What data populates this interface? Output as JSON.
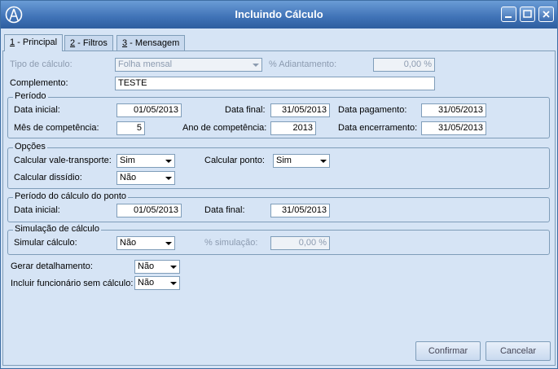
{
  "window": {
    "title": "Incluindo Cálculo"
  },
  "tabs": [
    {
      "num": "1",
      "label": " - Principal"
    },
    {
      "num": "2",
      "label": " - Filtros"
    },
    {
      "num": "3",
      "label": " - Mensagem"
    }
  ],
  "principal": {
    "tipo_calculo_label": "Tipo de cálculo:",
    "tipo_calculo_value": "Folha mensal",
    "adiantamento_label": "% Adiantamento:",
    "adiantamento_value": "0,00 %",
    "complemento_label": "Complemento:",
    "complemento_value": "TESTE"
  },
  "periodo": {
    "title": "Período",
    "data_inicial_label": "Data inicial:",
    "data_inicial_value": "01/05/2013",
    "data_final_label": "Data final:",
    "data_final_value": "31/05/2013",
    "data_pagamento_label": "Data pagamento:",
    "data_pagamento_value": "31/05/2013",
    "mes_label": "Mês de competência:",
    "mes_value": "5",
    "ano_label": "Ano de competência:",
    "ano_value": "2013",
    "encerramento_label": "Data encerramento:",
    "encerramento_value": "31/05/2013"
  },
  "opcoes": {
    "title": "Opções",
    "vale_label": "Calcular vale-transporte:",
    "vale_value": "Sim",
    "ponto_label": "Calcular ponto:",
    "ponto_value": "Sim",
    "dissidio_label": "Calcular dissídio:",
    "dissidio_value": "Não"
  },
  "ponto": {
    "title": "Período do cálculo do ponto",
    "data_inicial_label": "Data inicial:",
    "data_inicial_value": "01/05/2013",
    "data_final_label": "Data final:",
    "data_final_value": "31/05/2013"
  },
  "simulacao": {
    "title": "Simulação de cálculo",
    "simular_label": "Simular cálculo:",
    "simular_value": "Não",
    "percent_label": "% simulação:",
    "percent_value": "0,00 %"
  },
  "extras": {
    "detalhamento_label": "Gerar detalhamento:",
    "detalhamento_value": "Não",
    "incluir_label": "Incluir funcionário sem cálculo:",
    "incluir_value": "Não"
  },
  "buttons": {
    "confirm": "Confirmar",
    "cancel": "Cancelar"
  }
}
